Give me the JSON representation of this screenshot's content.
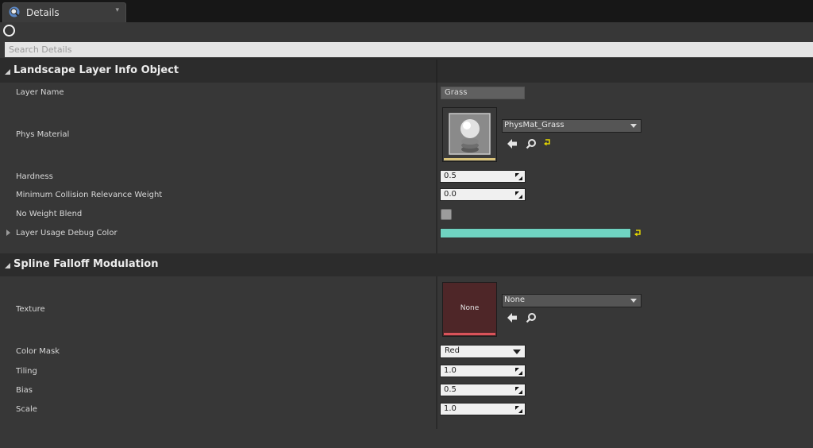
{
  "tab": {
    "title": "Details",
    "icon": "details-magnifier-icon",
    "menu_glyph": "▾"
  },
  "toolbar": {
    "icon": "lock-ring-icon"
  },
  "search": {
    "placeholder": "Search Details",
    "value": ""
  },
  "sections": [
    {
      "title": "Landscape Layer Info Object",
      "properties": {
        "layer_name": {
          "label": "Layer Name",
          "value": "Grass"
        },
        "phys_material": {
          "label": "Phys Material",
          "asset": "PhysMat_Grass"
        },
        "hardness": {
          "label": "Hardness",
          "value": "0.5"
        },
        "min_collision": {
          "label": "Minimum Collision Relevance Weight",
          "value": "0.0"
        },
        "no_weight_blend": {
          "label": "No Weight Blend",
          "checked": false
        },
        "debug_color": {
          "label": "Layer Usage Debug Color",
          "color": "#6fd3c1"
        }
      }
    },
    {
      "title": "Spline Falloff Modulation",
      "properties": {
        "texture": {
          "label": "Texture",
          "asset": "None",
          "thumb_text": "None"
        },
        "color_mask": {
          "label": "Color Mask",
          "value": "Red"
        },
        "tiling": {
          "label": "Tiling",
          "value": "1.0"
        },
        "bias": {
          "label": "Bias",
          "value": "0.5"
        },
        "scale": {
          "label": "Scale",
          "value": "1.0"
        }
      }
    }
  ],
  "colors": {
    "background": "#373737",
    "section_header": "#2c2c2c",
    "reset_arrow": "#e6d800",
    "phys_thumb_bar": "#d8c27a",
    "texture_thumb_bar": "#d9535a",
    "texture_thumb_bg": "#4e2628"
  }
}
